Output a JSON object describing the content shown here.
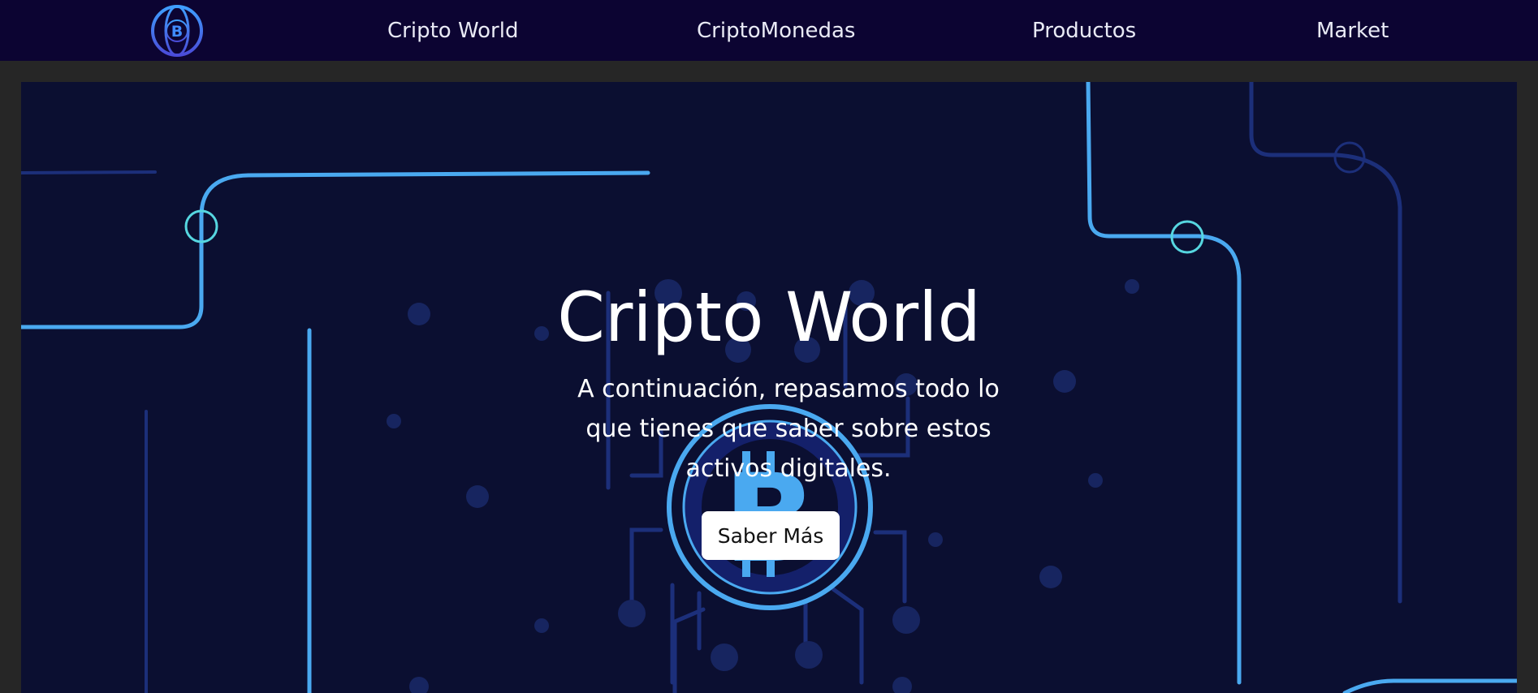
{
  "navbar": {
    "logo_icon": "bitcoin-globe-icon",
    "links": [
      {
        "label": "Cripto World"
      },
      {
        "label": "CriptoMonedas"
      },
      {
        "label": "Productos"
      },
      {
        "label": "Market"
      }
    ]
  },
  "hero": {
    "title": "Cripto World",
    "subtitle": "A continuación, repasamos todo lo que tienes que saber sobre estos activos digitales.",
    "button_label": "Saber Más",
    "background_icon": "bitcoin-circuit-icon"
  },
  "colors": {
    "page_background": "#262626",
    "navbar_background": "#0c0432",
    "hero_background": "#0b0f31",
    "accent_light_blue": "#4aa9f0",
    "accent_cyan": "#56d6e0",
    "circuit_dark_blue": "#1a2868",
    "button_background": "#ffffff"
  }
}
